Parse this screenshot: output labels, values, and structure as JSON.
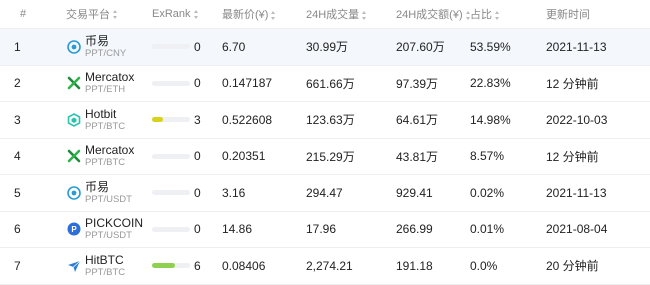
{
  "columns": {
    "rank": "#",
    "exchange": "交易平台",
    "exrank": "ExRank",
    "price": "最新价(¥)",
    "volume": "24H成交量",
    "amount": "24H成交额(¥)",
    "share": "占比",
    "updated": "更新时间"
  },
  "rows": [
    {
      "rank": "1",
      "name": "币易",
      "pair": "PPT/CNY",
      "exrank": "0",
      "bar": 0.0,
      "bar_color": "#cccccc",
      "price": "6.70",
      "volume": "30.99万",
      "amount": "207.60万",
      "share": "53.59%",
      "updated": "2021-11-13",
      "logo": "biyi-logo-icon"
    },
    {
      "rank": "2",
      "name": "Mercatox",
      "pair": "PPT/ETH",
      "exrank": "0",
      "bar": 0.0,
      "bar_color": "#cccccc",
      "price": "0.147187",
      "volume": "661.66万",
      "amount": "97.39万",
      "share": "22.83%",
      "updated": "12 分钟前",
      "logo": "mercatox-logo-icon"
    },
    {
      "rank": "3",
      "name": "Hotbit",
      "pair": "PPT/BTC",
      "exrank": "3",
      "bar": 0.3,
      "bar_color": "#d8d21a",
      "price": "0.522608",
      "volume": "123.63万",
      "amount": "64.61万",
      "share": "14.98%",
      "updated": "2022-10-03",
      "logo": "hotbit-logo-icon"
    },
    {
      "rank": "4",
      "name": "Mercatox",
      "pair": "PPT/BTC",
      "exrank": "0",
      "bar": 0.0,
      "bar_color": "#cccccc",
      "price": "0.20351",
      "volume": "215.29万",
      "amount": "43.81万",
      "share": "8.57%",
      "updated": "12 分钟前",
      "logo": "mercatox-logo-icon"
    },
    {
      "rank": "5",
      "name": "币易",
      "pair": "PPT/USDT",
      "exrank": "0",
      "bar": 0.0,
      "bar_color": "#cccccc",
      "price": "3.16",
      "volume": "294.47",
      "amount": "929.41",
      "share": "0.02%",
      "updated": "2021-11-13",
      "logo": "biyi-logo-icon"
    },
    {
      "rank": "6",
      "name": "PICKCOIN",
      "pair": "PPT/USDT",
      "exrank": "0",
      "bar": 0.0,
      "bar_color": "#cccccc",
      "price": "14.86",
      "volume": "17.96",
      "amount": "266.99",
      "share": "0.01%",
      "updated": "2021-08-04",
      "logo": "pickcoin-logo-icon"
    },
    {
      "rank": "7",
      "name": "HitBTC",
      "pair": "PPT/BTC",
      "exrank": "6",
      "bar": 0.6,
      "bar_color": "#8fd14f",
      "price": "0.08406",
      "volume": "2,274.21",
      "amount": "191.18",
      "share": "0.0%",
      "updated": "20 分钟前",
      "logo": "hitbtc-logo-icon"
    }
  ]
}
